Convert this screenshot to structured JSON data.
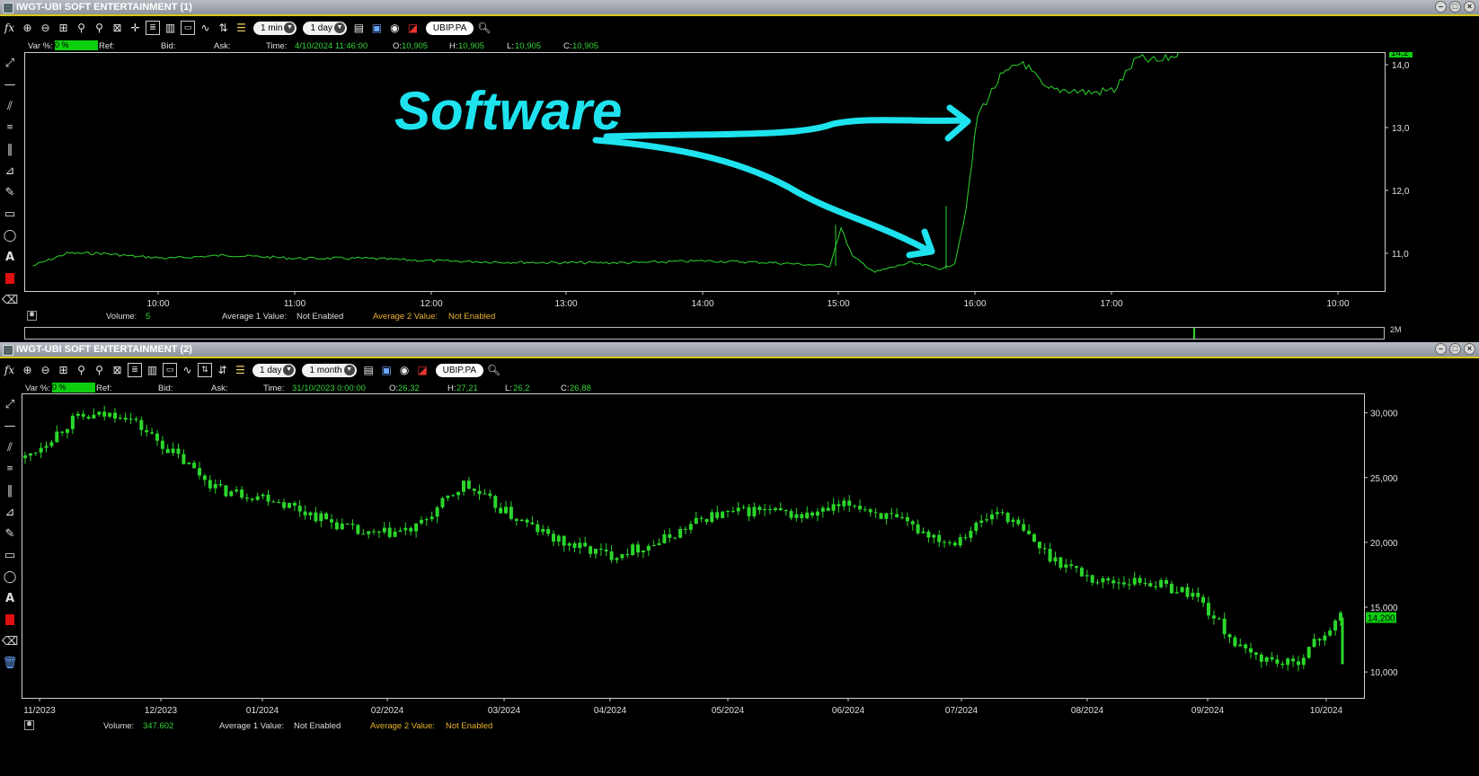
{
  "window1": {
    "title": "IWGT-UBI SOFT ENTERTAINMENT (1)",
    "interval": "1 min",
    "period": "1 day",
    "symbol": "UBIP.PA",
    "info": {
      "var_label": "Var %:",
      "var_value": "0 %",
      "ref_label": "Ref:",
      "bid_label": "Bid:",
      "ask_label": "Ask:",
      "time_label": "Time:",
      "time_value": "4/10/2024 11:46:00",
      "open_label": "O:",
      "open_value": "10,905",
      "high_label": "H:",
      "high_value": "10,905",
      "low_label": "L:",
      "low_value": "10,905",
      "close_label": "C:",
      "close_value": "10,905"
    },
    "x_ticks": [
      "10:00",
      "11:00",
      "12:00",
      "13:00",
      "14:00",
      "15:00",
      "16:00",
      "17:00",
      "10:00"
    ],
    "y_ticks": [
      "14,0",
      "13,0",
      "12,0",
      "11,0"
    ],
    "last_price": "14,2",
    "annotation_text": "Software",
    "volume_label": "Volume:",
    "volume_value": "5",
    "avg1_label": "Average 1 Value:",
    "avg1_value": "Not Enabled",
    "avg2_label": "Average 2 Value:",
    "avg2_value": "Not Enabled",
    "scroll_label": "2M"
  },
  "window2": {
    "title": "IWGT-UBI SOFT ENTERTAINMENT (2)",
    "interval": "1 day",
    "period": "1 month",
    "symbol": "UBIP.PA",
    "info": {
      "var_label": "Var %:",
      "var_value": "0 %",
      "ref_label": "Ref:",
      "bid_label": "Bid:",
      "ask_label": "Ask:",
      "time_label": "Time:",
      "time_value": "31/10/2023 0:00:00",
      "open_label": "O:",
      "open_value": "26,32",
      "high_label": "H:",
      "high_value": "27,21",
      "low_label": "L:",
      "low_value": "26,2",
      "close_label": "C:",
      "close_value": "26,88"
    },
    "x_ticks": [
      "11/2023",
      "12/2023",
      "01/2024",
      "02/2024",
      "03/2024",
      "04/2024",
      "05/2024",
      "06/2024",
      "07/2024",
      "08/2024",
      "09/2024",
      "10/2024"
    ],
    "y_ticks": [
      "30,000",
      "25,000",
      "20,000",
      "15,000",
      "10,000"
    ],
    "last_price": "14,200",
    "volume_label": "Volume:",
    "volume_value": "347.602",
    "avg1_label": "Average 1 Value:",
    "avg1_value": "Not Enabled",
    "avg2_label": "Average 2 Value:",
    "avg2_value": "Not Enabled"
  },
  "colors": {
    "price_line": "#2bd62b",
    "annotation": "#1ee3ee",
    "accent_yellow": "#e8b32e",
    "title_yellow_line": "#d8c81a",
    "highlight_green": "#0ecf0e",
    "color_swatch": "#e01010"
  },
  "chart_data": [
    {
      "type": "line",
      "title": "IWGT-UBI SOFT ENTERTAINMENT (1)",
      "xlabel": "",
      "ylabel": "",
      "x_ticks": [
        "10:00",
        "11:00",
        "12:00",
        "13:00",
        "14:00",
        "15:00",
        "16:00",
        "17:00",
        "10:00"
      ],
      "ylim": [
        10.4,
        14.2
      ],
      "series": [
        {
          "x": [
            "09:05",
            "09:20",
            "09:35",
            "09:50",
            "10:05",
            "10:30",
            "11:00",
            "11:30",
            "12:00",
            "12:30",
            "13:00",
            "13:30",
            "14:00",
            "14:30",
            "14:55",
            "15:00",
            "15:05",
            "15:15",
            "15:30",
            "15:45",
            "15:50",
            "15:55",
            "16:00",
            "16:10",
            "16:20",
            "16:30",
            "16:40",
            "16:50",
            "17:00",
            "17:10",
            "17:20",
            "17:30"
          ],
          "values": [
            10.8,
            11.0,
            11.0,
            10.95,
            10.92,
            10.97,
            10.92,
            10.92,
            10.88,
            10.86,
            10.85,
            10.85,
            10.88,
            10.85,
            10.8,
            11.4,
            10.95,
            10.7,
            10.85,
            10.75,
            10.85,
            11.7,
            13.2,
            13.8,
            14.05,
            13.6,
            13.6,
            13.55,
            13.6,
            14.1,
            14.05,
            14.2
          ]
        }
      ]
    },
    {
      "type": "bar",
      "title": "IWGT-UBI SOFT ENTERTAINMENT (2)",
      "xlabel": "",
      "ylabel": "",
      "x_ticks": [
        "11/2023",
        "12/2023",
        "01/2024",
        "02/2024",
        "03/2024",
        "04/2024",
        "05/2024",
        "06/2024",
        "07/2024",
        "08/2024",
        "09/2024",
        "10/2024"
      ],
      "ylim": [
        8.0,
        31.5
      ],
      "series": [
        {
          "x": [
            "11/2023",
            "mid 11/2023",
            "late 11/2023",
            "12/2023",
            "mid 12/2023",
            "01/2024",
            "mid 01/2024",
            "02/2024",
            "mid 02/2024",
            "late 02/2024",
            "03/2024",
            "mid 03/2024",
            "04/2024",
            "mid 04/2024",
            "05/2024",
            "mid 05/2024",
            "06/2024",
            "mid 06/2024",
            "07/2024",
            "mid 07/2024",
            "late 07/2024",
            "08/2024",
            "mid 08/2024",
            "09/2024",
            "mid 09/2024",
            "late 09/2024",
            "10/2024",
            "mid 10/2024"
          ],
          "values": [
            26.5,
            29.5,
            30.0,
            27.0,
            24.0,
            23.5,
            22.0,
            20.5,
            21.0,
            24.5,
            22.0,
            20.0,
            19.0,
            20.0,
            22.0,
            22.5,
            22.0,
            23.0,
            21.5,
            20.0,
            22.5,
            19.0,
            17.0,
            17.0,
            16.0,
            11.5,
            10.5,
            14.2
          ]
        }
      ]
    }
  ]
}
